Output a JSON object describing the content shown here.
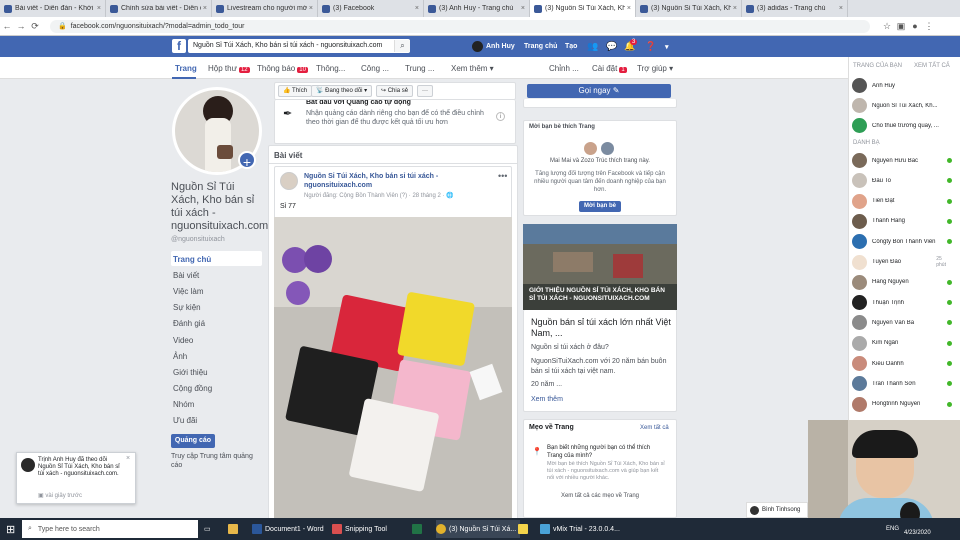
{
  "browser": {
    "tabs": [
      {
        "title": "Bài viết - Diễn đàn - Khởi N",
        "active": false
      },
      {
        "title": "Chỉnh sửa bài viết - Diễn đà",
        "active": false
      },
      {
        "title": "Livestream cho người mới b",
        "active": false
      },
      {
        "title": "(3) Facebook",
        "active": false
      },
      {
        "title": "(3) Anh Huy - Trang chủ",
        "active": false
      },
      {
        "title": "(3) Nguồn Sỉ Túi Xách, Kho",
        "active": true
      },
      {
        "title": "(3) Nguồn Sỉ Túi Xách, Kho",
        "active": false
      },
      {
        "title": "(3) adidas - Trang chủ",
        "active": false
      }
    ],
    "url": "facebook.com/nguonsituixach/?modal=admin_todo_tour"
  },
  "fb": {
    "search_value": "Nguồn Sỉ Túi Xách, Kho bán sỉ túi xách - nguonsituixach.com",
    "user": "Anh Huy",
    "home": "Trang chủ",
    "create": "Tạo",
    "notif_count": "3"
  },
  "pagenav": {
    "items": [
      {
        "label": "Trang",
        "badge": ""
      },
      {
        "label": "Hộp thư",
        "badge": "12"
      },
      {
        "label": "Thông báo",
        "badge": "10"
      },
      {
        "label": "Thông...",
        "badge": ""
      },
      {
        "label": "Công ...",
        "badge": ""
      },
      {
        "label": "Trung ...",
        "badge": ""
      },
      {
        "label": "Xem thêm ▾",
        "badge": ""
      }
    ],
    "right": [
      {
        "label": "Chỉnh ...",
        "badge": ""
      },
      {
        "label": "Cài đặt",
        "badge": "1"
      },
      {
        "label": "Trợ giúp ▾",
        "badge": ""
      }
    ]
  },
  "page": {
    "name": "Nguồn Sỉ Túi Xách, Kho bán sỉ túi xách - nguonsituixach.com",
    "handle": "@nguonsituixach",
    "menu": [
      "Trang chủ",
      "Bài viết",
      "Việc làm",
      "Sự kiện",
      "Đánh giá",
      "Video",
      "Ảnh",
      "Giới thiệu",
      "Cộng đồng",
      "Nhóm",
      "Ưu đãi"
    ],
    "ads_button": "Quảng cáo",
    "ads_center": "Truy cập Trung tâm quảng cáo"
  },
  "actions": {
    "like": "Thích",
    "following": "Đang theo dõi",
    "share": "Chia sẻ",
    "more": "···",
    "call": "Gọi ngay"
  },
  "promo": {
    "title": "Bắt đầu với Quảng cáo tự động",
    "text": "Nhận quảng cáo dành riêng cho bạn để có thể điều chỉnh theo thời gian để thu được kết quả tối ưu hơn"
  },
  "posts": {
    "section_title": "Bài viết",
    "author": "Nguồn Sỉ Túi Xách, Kho bán sỉ túi xách - nguonsituixach.com",
    "meta": "Người đăng: Cộng Bồn Thành Viên (?) · 28 tháng 2 · 🌐",
    "text": "Sỉ 77"
  },
  "invite": {
    "title": "Mời bạn bè thích Trang",
    "liked": "Mai Mai và Zozo Trúc thích trang này.",
    "desc": "Tăng lượng đối tượng trên Facebook và tiếp cận nhiều người quan tâm đến doanh nghiệp của bạn hơn.",
    "button": "Mời bạn bè"
  },
  "video": {
    "caption": "GIỚI THIỆU NGUỒN SỈ TÚI XÁCH, KHO BÁN SỈ TÚI XÁCH - NGUONSITUIXACH.COM"
  },
  "about": {
    "title": "Nguồn bán sỉ túi xách lớn nhất Việt Nam, ...",
    "q": "Nguồn sỉ túi xách ở đâu?",
    "desc": "NguonSiTuiXach.com với 20 năm bán buôn bán sỉ túi xách tại việt nam.",
    "years": "20 năm ...",
    "more": "Xem thêm"
  },
  "tips": {
    "title": "Mẹo về Trang",
    "see_all": "Xem tất cả",
    "q": "Bạn biết những người bạn có thể thích Trang của mình?",
    "desc": "Mời bạn bè thích Nguồn Sỉ Túi Xách, Kho bán sỉ túi xách - nguonsituixach.com và giúp bạn kết nối với nhiều người khác.",
    "footer": "Xem tất cả các mẹo về Trang"
  },
  "toast": {
    "text": "Trịnh Anh Huy đã theo dõi Nguồn Sỉ Túi Xách, Kho bán sỉ túi xách - nguonsituixach.com.",
    "time": "vài giây trước"
  },
  "sidebar": {
    "pages_title": "TRANG CỦA BẠN",
    "see_all": "XEM TẤT CẢ",
    "pages": [
      "Anh Huy",
      "Nguồn Sỉ Túi Xách, Kh...",
      "Cho thuê trường quay, ..."
    ],
    "contacts_title": "DANH BẠ",
    "contacts": [
      {
        "name": "Nguyễn Hữu Bắc",
        "status": "dot"
      },
      {
        "name": "Đầu To",
        "status": "dot"
      },
      {
        "name": "Tiến Đạt",
        "status": "dot"
      },
      {
        "name": "Thanh Hằng",
        "status": "dot"
      },
      {
        "name": "Công̃ty Bồn Thành Viên",
        "status": "dot"
      },
      {
        "name": "Tuyền Đào",
        "status": "25 phút"
      },
      {
        "name": "Hang Nguyen",
        "status": "dot"
      },
      {
        "name": "Thuận Trịnh",
        "status": "dot"
      },
      {
        "name": "Nguyễn Văn Ba",
        "status": "dot"
      },
      {
        "name": "Kim Ngân",
        "status": "dot"
      },
      {
        "name": "Kiều Oanhh",
        "status": "dot"
      },
      {
        "name": "Trần Thanh Sơn",
        "status": "dot"
      },
      {
        "name": "Hongtrinh Nguyen",
        "status": "dot"
      }
    ],
    "chat_user": "Bình Tinhsong"
  },
  "taskbar": {
    "search": "Type here to search",
    "apps": [
      "Document1 - Word",
      "Snipping Tool",
      "(3) Nguồn Sỉ Túi Xá...",
      "vMix Trial - 23.0.0.4..."
    ],
    "lang": "ENG",
    "date": "4/23/2020"
  },
  "colors": {
    "fb_blue": "#4267b2",
    "badge_red": "#e41e3f",
    "online": "#42b72a"
  }
}
